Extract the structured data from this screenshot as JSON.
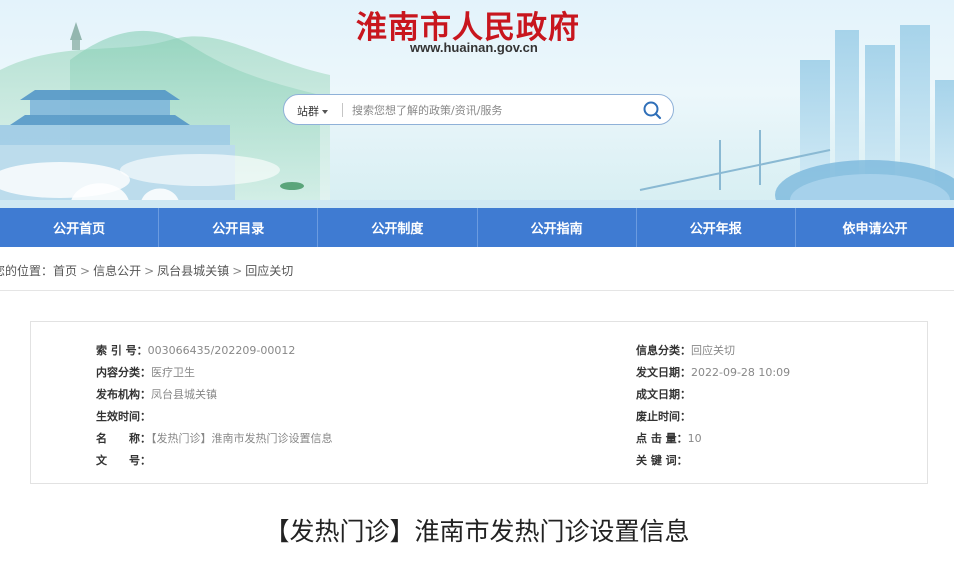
{
  "header": {
    "title": "淮南市人民政府",
    "url": "www.huainan.gov.cn"
  },
  "search": {
    "scope_label": "站群",
    "placeholder": "搜索您想了解的政策/资讯/服务"
  },
  "icons": {
    "search": "search-icon",
    "dropdown": "chevron-down-icon"
  },
  "nav": {
    "items": [
      "公开首页",
      "公开目录",
      "公开制度",
      "公开指南",
      "公开年报",
      "依申请公开"
    ]
  },
  "breadcrumb": {
    "prefix": "您的位置：",
    "separator": ">",
    "items": [
      "首页",
      "信息公开",
      "凤台县城关镇",
      "回应关切"
    ]
  },
  "meta": {
    "index_no": {
      "label": "索 引 号：",
      "value": "003066435/202209-00012"
    },
    "category": {
      "label": "信息分类：",
      "value": "回应关切"
    },
    "content_type": {
      "label": "内容分类：",
      "value": "医疗卫生"
    },
    "issue_date": {
      "label": "发文日期：",
      "value": "2022-09-28 10:09"
    },
    "issuer": {
      "label": "发布机构：",
      "value": "凤台县城关镇"
    },
    "written_date": {
      "label": "成文日期：",
      "value": ""
    },
    "effective_date": {
      "label": "生效时间：",
      "value": ""
    },
    "expire_date": {
      "label": "废止时间：",
      "value": ""
    },
    "name": {
      "label": "名　　称：",
      "value": "【发热门诊】淮南市发热门诊设置信息"
    },
    "clicks": {
      "label": "点 击 量：",
      "value": "10"
    },
    "doc_no": {
      "label": "文　　号：",
      "value": ""
    },
    "keywords": {
      "label": "关 键 词：",
      "value": ""
    }
  },
  "article": {
    "title": "【发热门诊】淮南市发热门诊设置信息"
  },
  "colors": {
    "brand_red": "#c8161e",
    "nav_blue": "#3f7bd2"
  }
}
